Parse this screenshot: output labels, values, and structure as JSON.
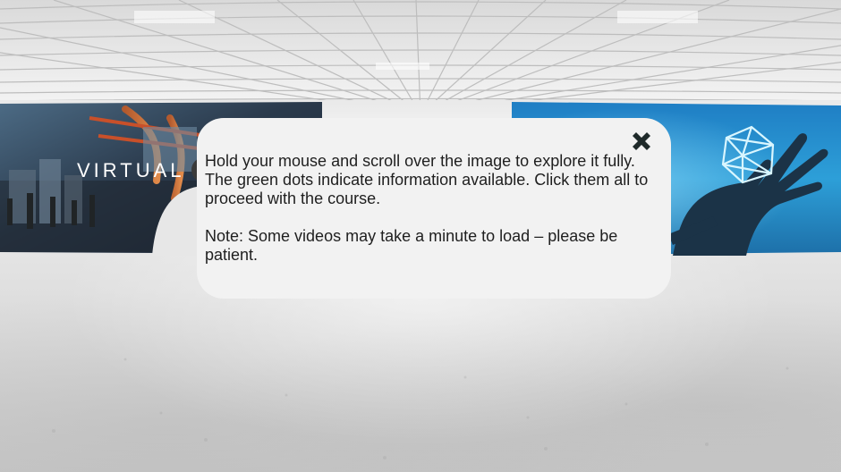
{
  "panels": {
    "left_caption": "VIRTUAL"
  },
  "dialog": {
    "paragraph_1": "Hold your mouse and scroll over the image to explore it fully. The green dots indicate information available. Click them all to proceed with the course.",
    "paragraph_2": "Note: Some videos may take a minute to load – please be patient.",
    "close_icon": "close-icon"
  },
  "colors": {
    "dialog_background": "#f2f2f2",
    "text": "#1f1f1f",
    "close_icon": "#1f2a2a"
  }
}
